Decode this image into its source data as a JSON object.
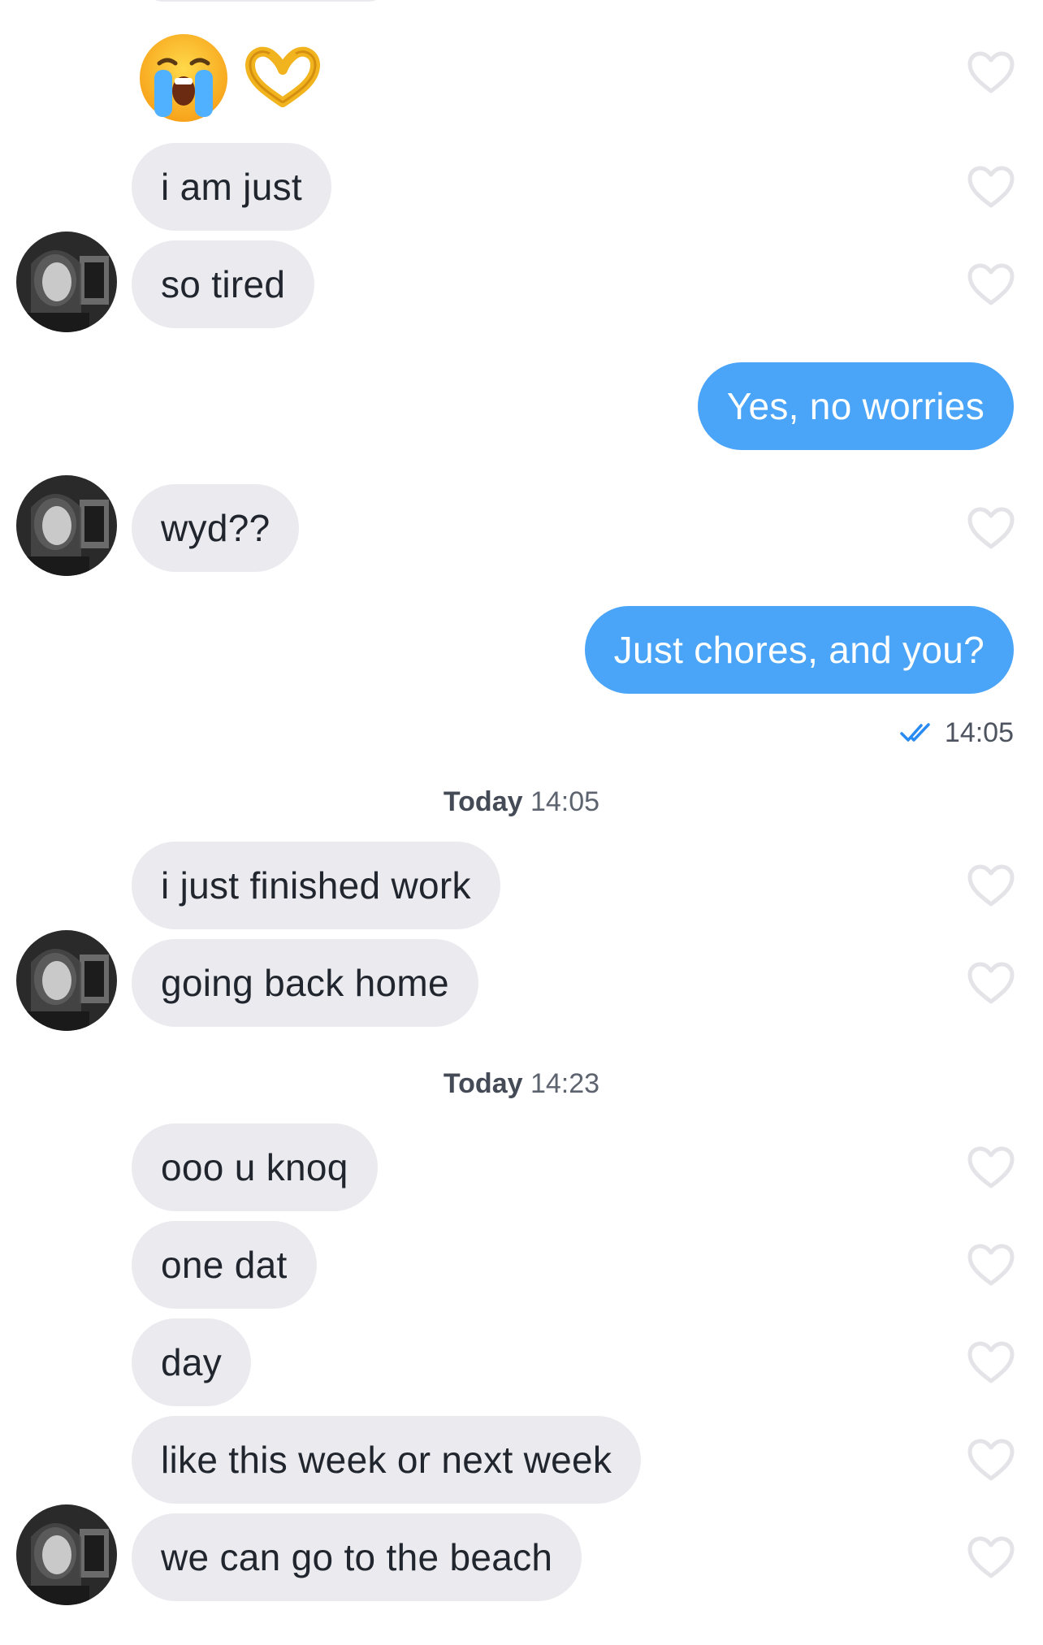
{
  "messages": {
    "emoji_row": {
      "emojis": [
        "😭",
        "🫶"
      ]
    },
    "m1": "i am just",
    "m2": "so tired",
    "m3": "Yes, no worries",
    "m4": "wyd??",
    "m5": "Just chores, and you?",
    "receipt_time": "14:05",
    "divider1": {
      "day": "Today",
      "time": "14:05"
    },
    "m6": "i just finished work",
    "m7": "going back home",
    "divider2": {
      "day": "Today",
      "time": "14:23"
    },
    "m8": "ooo u knoq",
    "m9": "one dat",
    "m10": "day",
    "m11": "like this week or next week",
    "m12": "we can go to the beach"
  },
  "colors": {
    "incoming_bubble": "#eaeaef",
    "outgoing_bubble": "#4aa4f7",
    "heart_outline": "#e4e4e8",
    "read_check": "#2a8bf2"
  },
  "icons": {
    "like": "heart-outline-icon",
    "read": "double-check-icon"
  }
}
